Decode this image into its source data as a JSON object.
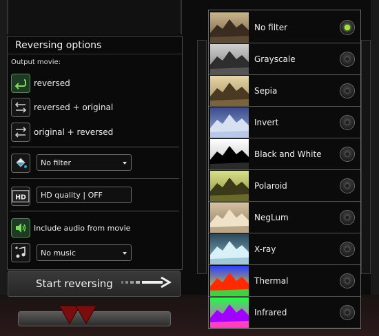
{
  "panel": {
    "title": "Reversing options",
    "output_label": "Output movie:",
    "options": [
      {
        "label": "reversed",
        "icon": "reverse-arrow-icon"
      },
      {
        "label": "reversed + original",
        "icon": "reverse-then-original-icon"
      },
      {
        "label": "original + reversed",
        "icon": "original-then-reverse-icon"
      }
    ],
    "filter_select": {
      "value": "No filter",
      "icon": "paint-bucket-icon"
    },
    "hd_quality": {
      "label": "HD quality | OFF",
      "badge_text": "HD"
    },
    "audio": {
      "label": "Include audio from movie",
      "icon": "speaker-icon"
    },
    "music_select": {
      "value": "No music",
      "icon": "add-music-icon"
    }
  },
  "start_button": {
    "label": "Start reversing"
  },
  "filters": [
    {
      "label": "No filter",
      "selected": true
    },
    {
      "label": "Grayscale",
      "selected": false
    },
    {
      "label": "Sepia",
      "selected": false
    },
    {
      "label": "Invert",
      "selected": false
    },
    {
      "label": "Black and White",
      "selected": false
    },
    {
      "label": "Polaroid",
      "selected": false
    },
    {
      "label": "NegLum",
      "selected": false
    },
    {
      "label": "X-ray",
      "selected": false
    },
    {
      "label": "Thermal",
      "selected": false
    },
    {
      "label": "Infrared",
      "selected": false
    }
  ],
  "colors": {
    "accent_green": "#9be03b",
    "panel_bg": "#0a0a0a",
    "border": "#4a4a4a"
  }
}
